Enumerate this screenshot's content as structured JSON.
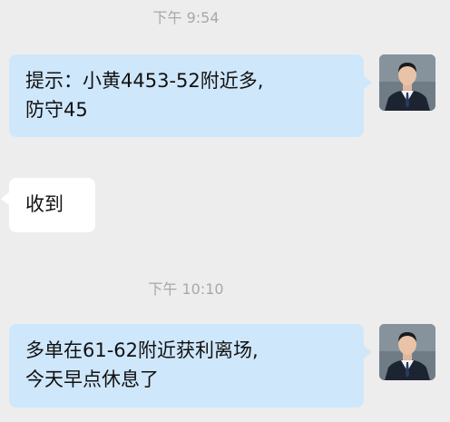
{
  "messages": [
    {
      "type": "timestamp",
      "text": "下午 9:54"
    },
    {
      "type": "outgoing",
      "lines": [
        "提示：小黄4453-52附近多,",
        "防守45"
      ]
    },
    {
      "type": "incoming",
      "lines": [
        "收到"
      ]
    },
    {
      "type": "timestamp",
      "text": "下午 10:10"
    },
    {
      "type": "outgoing",
      "lines": [
        "多单在61-62附近获利离场,",
        "今天早点休息了"
      ]
    }
  ],
  "icons": {
    "avatar": "man-in-suit-avatar-icon"
  }
}
